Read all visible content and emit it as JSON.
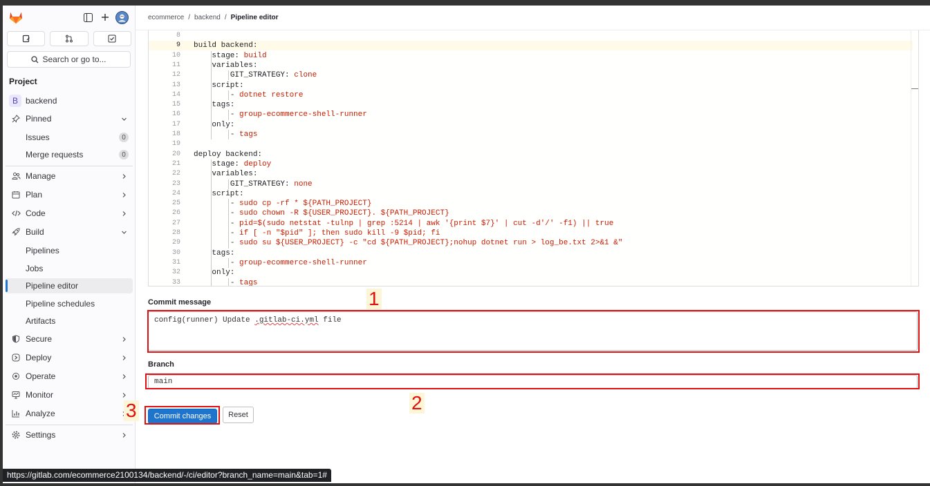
{
  "sidebar": {
    "search_label": "Search or go to...",
    "section_title": "Project",
    "project": {
      "initial": "B",
      "name": "backend"
    },
    "pinned": {
      "label": "Pinned",
      "items": [
        {
          "label": "Issues",
          "count": "0"
        },
        {
          "label": "Merge requests",
          "count": "0"
        }
      ]
    },
    "groups": [
      {
        "label": "Manage",
        "icon": "users-icon"
      },
      {
        "label": "Plan",
        "icon": "calendar-icon"
      },
      {
        "label": "Code",
        "icon": "code-icon"
      },
      {
        "label": "Build",
        "icon": "rocket-icon"
      }
    ],
    "build_items": [
      "Pipelines",
      "Jobs",
      "Pipeline editor",
      "Pipeline schedules",
      "Artifacts"
    ],
    "more_groups": [
      {
        "label": "Secure",
        "icon": "shield-icon"
      },
      {
        "label": "Deploy",
        "icon": "deploy-icon"
      },
      {
        "label": "Operate",
        "icon": "cloud-gear-icon"
      },
      {
        "label": "Monitor",
        "icon": "monitor-icon"
      },
      {
        "label": "Analyze",
        "icon": "chart-icon"
      }
    ],
    "settings_label": "Settings"
  },
  "breadcrumb": [
    "ecommerce",
    "backend",
    "Pipeline editor"
  ],
  "editor": {
    "lines": [
      {
        "n": "8",
        "code": ""
      },
      {
        "n": "9",
        "code": "build backend:"
      },
      {
        "n": "10",
        "code": "    stage: build"
      },
      {
        "n": "11",
        "code": "    variables:"
      },
      {
        "n": "12",
        "code": "        GIT_STRATEGY: clone"
      },
      {
        "n": "13",
        "code": "    script:"
      },
      {
        "n": "14",
        "code": "        - dotnet restore"
      },
      {
        "n": "15",
        "code": "    tags:"
      },
      {
        "n": "16",
        "code": "        - group-ecommerce-shell-runner"
      },
      {
        "n": "17",
        "code": "    only:"
      },
      {
        "n": "18",
        "code": "        - tags"
      },
      {
        "n": "19",
        "code": ""
      },
      {
        "n": "20",
        "code": "deploy backend:"
      },
      {
        "n": "21",
        "code": "    stage: deploy"
      },
      {
        "n": "22",
        "code": "    variables:"
      },
      {
        "n": "23",
        "code": "        GIT_STRATEGY: none"
      },
      {
        "n": "24",
        "code": "    script:"
      },
      {
        "n": "25",
        "code": "        - sudo cp -rf * ${PATH_PROJECT}"
      },
      {
        "n": "26",
        "code": "        - sudo chown -R ${USER_PROJECT}. ${PATH_PROJECT}"
      },
      {
        "n": "27",
        "code": "        - pid=$(sudo netstat -tulnp | grep :5214 | awk '{print $7}' | cut -d'/' -f1) || true"
      },
      {
        "n": "28",
        "code": "        - if [ -n \"$pid\" ]; then sudo kill -9 $pid; fi"
      },
      {
        "n": "29",
        "code": "        - sudo su ${USER_PROJECT} -c \"cd ${PATH_PROJECT};nohup dotnet run > log_be.txt 2>&1 &\""
      },
      {
        "n": "30",
        "code": "    tags:"
      },
      {
        "n": "31",
        "code": "        - group-ecommerce-shell-runner"
      },
      {
        "n": "32",
        "code": "    only:"
      },
      {
        "n": "33",
        "code": "        - tags"
      }
    ],
    "current_line": "9"
  },
  "commit": {
    "message_label": "Commit message",
    "message_prefix": "config(runner) Update ",
    "message_misspelled": ".gitlab-ci.yml",
    "message_suffix": " file",
    "branch_label": "Branch",
    "branch_value": "main",
    "commit_button": "Commit changes",
    "reset_button": "Reset"
  },
  "annotations": [
    "1",
    "2",
    "3"
  ],
  "status_url": "https://gitlab.com/ecommerce2100134/backend/-/ci/editor?branch_name=main&tab=1#",
  "colors": {
    "accent": "#1f75cb",
    "annotation": "#e01010",
    "value": "#c91c00"
  }
}
